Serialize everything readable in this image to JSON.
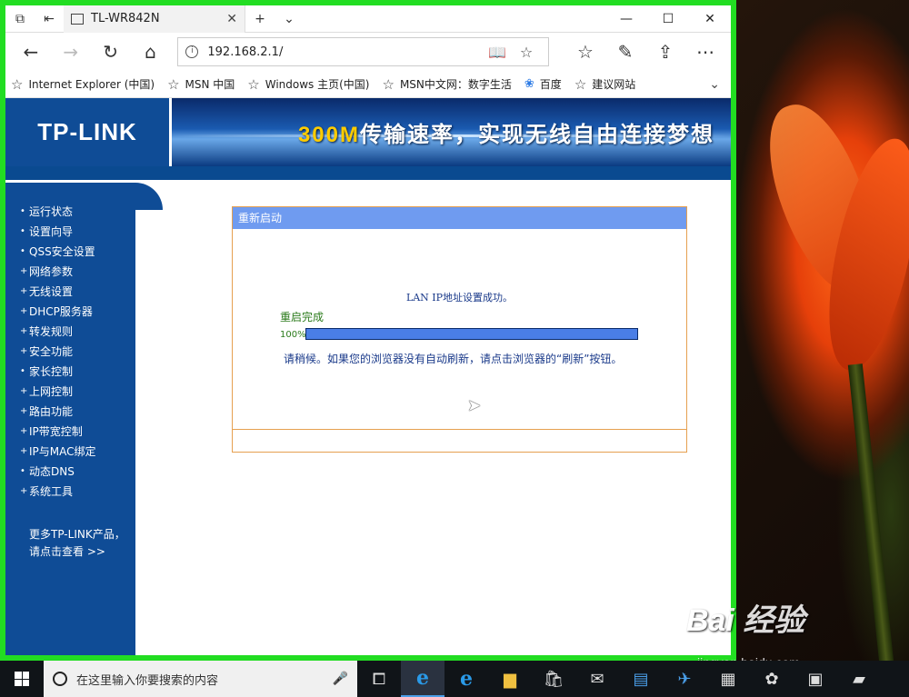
{
  "browser": {
    "tab_title": "TL-WR842N",
    "url": "192.168.2.1/",
    "window_controls": [
      "minimize",
      "maximize",
      "close"
    ],
    "favorites": [
      {
        "label": "Internet Explorer (中国)",
        "icon": "star-icon"
      },
      {
        "label": "MSN 中国",
        "icon": "star-icon"
      },
      {
        "label": "Windows 主页(中国)",
        "icon": "star-icon"
      },
      {
        "label": "MSN中文网：数字生活",
        "icon": "star-icon"
      },
      {
        "label": "百度",
        "icon": "paw-icon"
      },
      {
        "label": "建议网站",
        "icon": "star-icon"
      }
    ]
  },
  "router": {
    "logo": "TP-LINK",
    "slogan_highlight": "300M",
    "slogan_rest": "传输速率，实现无线自由连接梦想",
    "menu": [
      {
        "bullet": "•",
        "label": "运行状态"
      },
      {
        "bullet": "•",
        "label": "设置向导"
      },
      {
        "bullet": "•",
        "label": "QSS安全设置"
      },
      {
        "bullet": "+",
        "label": "网络参数"
      },
      {
        "bullet": "+",
        "label": "无线设置"
      },
      {
        "bullet": "+",
        "label": "DHCP服务器"
      },
      {
        "bullet": "+",
        "label": "转发规则"
      },
      {
        "bullet": "+",
        "label": "安全功能"
      },
      {
        "bullet": "•",
        "label": "家长控制"
      },
      {
        "bullet": "+",
        "label": "上网控制"
      },
      {
        "bullet": "+",
        "label": "路由功能"
      },
      {
        "bullet": "+",
        "label": "IP带宽控制"
      },
      {
        "bullet": "+",
        "label": "IP与MAC绑定"
      },
      {
        "bullet": "•",
        "label": "动态DNS"
      },
      {
        "bullet": "+",
        "label": "系统工具"
      }
    ],
    "more_line1": "更多TP-LINK产品，",
    "more_line2": "请点击查看 >>",
    "panel": {
      "title": "重新启动",
      "lan_message": "LAN IP地址设置成功。",
      "status": "重启完成",
      "progress_label": "100%",
      "progress": 1.0,
      "wait_message": "请稍候。如果您的浏览器没有自动刷新，请点击浏览器的“刷新”按钮。"
    }
  },
  "taskbar": {
    "search_placeholder": "在这里输入你要搜索的内容"
  },
  "watermark": {
    "main": "Bai 经验",
    "sub": "jingyan.baidu.com"
  }
}
